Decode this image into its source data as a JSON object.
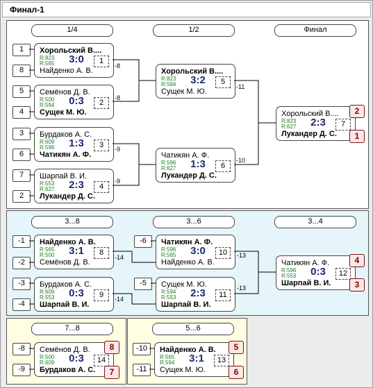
{
  "title": "Финал-1",
  "main": {
    "headers": [
      "1/4",
      "1/2",
      "Финал"
    ],
    "seeds": [
      "1",
      "8",
      "5",
      "4",
      "3",
      "6",
      "7",
      "2"
    ],
    "matches": [
      {
        "top": "Хорольский В....",
        "bottom": "Найденко А. В.",
        "r1": "R:823",
        "r2": "R:565",
        "score": "3:0",
        "num": "1",
        "winner": "top",
        "loser_next": "-8"
      },
      {
        "top": "Семёнов Д. В.",
        "bottom": "Сущек М. Ю.",
        "r1": "R:500",
        "r2": "R:594",
        "score": "0:3",
        "num": "2",
        "winner": "bottom",
        "loser_next": "-8"
      },
      {
        "top": "Бурдаков А. С.",
        "bottom": "Чатикян А. Ф.",
        "r1": "R:609",
        "r2": "R:596",
        "score": "1:3",
        "num": "3",
        "winner": "bottom",
        "loser_next": "-9"
      },
      {
        "top": "Шарпай В. И.",
        "bottom": "Лукандер Д. С.",
        "r1": "R:553",
        "r2": "R:627",
        "score": "2:3",
        "num": "4",
        "winner": "bottom",
        "loser_next": "-9"
      },
      {
        "top": "Хорольский В....",
        "bottom": "Сущек М. Ю.",
        "r1": "R:823",
        "r2": "R:594",
        "score": "3:2",
        "num": "5",
        "winner": "top",
        "loser_next": "-11"
      },
      {
        "top": "Чатикян А. Ф.",
        "bottom": "Лукандер Д. С.",
        "r1": "R:596",
        "r2": "R:627",
        "score": "1:3",
        "num": "6",
        "winner": "bottom",
        "loser_next": "-10"
      },
      {
        "top": "Хорольский В....",
        "bottom": "Лукандер Д. С.",
        "r1": "R:823",
        "r2": "R:627",
        "score": "2:3",
        "num": "7",
        "winner": "bottom",
        "place_top": "2",
        "place_bottom": "1"
      }
    ]
  },
  "consolation": {
    "headers": [
      "3...8",
      "3...6",
      "3...4"
    ],
    "seeds": [
      "-1",
      "-2",
      "-3",
      "-4",
      "-6",
      "-5"
    ],
    "matches": [
      {
        "top": "Найденко А. В.",
        "bottom": "Семёнов Д. В.",
        "r1": "R:565",
        "r2": "R:500",
        "score": "3:1",
        "num": "8",
        "winner": "top",
        "loser_next": "-14"
      },
      {
        "top": "Бурдаков А. С.",
        "bottom": "Шарпай В. И.",
        "r1": "R:609",
        "r2": "R:553",
        "score": "0:3",
        "num": "9",
        "winner": "bottom",
        "loser_next": "-14"
      },
      {
        "top": "Чатикян А. Ф.",
        "bottom": "Найденко А. В.",
        "r1": "R:596",
        "r2": "R:565",
        "score": "3:0",
        "num": "10",
        "winner": "top",
        "loser_next": "-13"
      },
      {
        "top": "Сущек М. Ю.",
        "bottom": "Шарпай В. И.",
        "r1": "R:594",
        "r2": "R:553",
        "score": "2:3",
        "num": "11",
        "winner": "bottom",
        "loser_next": "-13"
      },
      {
        "top": "Чатикян А. Ф.",
        "bottom": "Шарпай В. И.",
        "r1": "R:596",
        "r2": "R:553",
        "score": "0:3",
        "num": "12",
        "winner": "bottom",
        "place_top": "4",
        "place_bottom": "3"
      }
    ]
  },
  "p78": {
    "header": "7...8",
    "seeds": [
      "-8",
      "-9"
    ],
    "match": {
      "top": "Семёнов Д. В.",
      "bottom": "Бурдаков А. С.",
      "r1": "R:500",
      "r2": "R:609",
      "score": "0:3",
      "num": "14",
      "winner": "bottom",
      "place_top": "8",
      "place_bottom": "7"
    }
  },
  "p56": {
    "header": "5...6",
    "seeds": [
      "-10",
      "-11"
    ],
    "match": {
      "top": "Найденко А. В.",
      "bottom": "Сущек М. Ю.",
      "r1": "R:565",
      "r2": "R:594",
      "score": "3:1",
      "num": "13",
      "winner": "top",
      "place_top": "5",
      "place_bottom": "6"
    }
  },
  "colors": {
    "score": "#1a2a70",
    "rating": "#207a20",
    "place": "#8a0000",
    "consolation_bg": "#e6f5fa",
    "placement_bg": "#fffde2"
  }
}
